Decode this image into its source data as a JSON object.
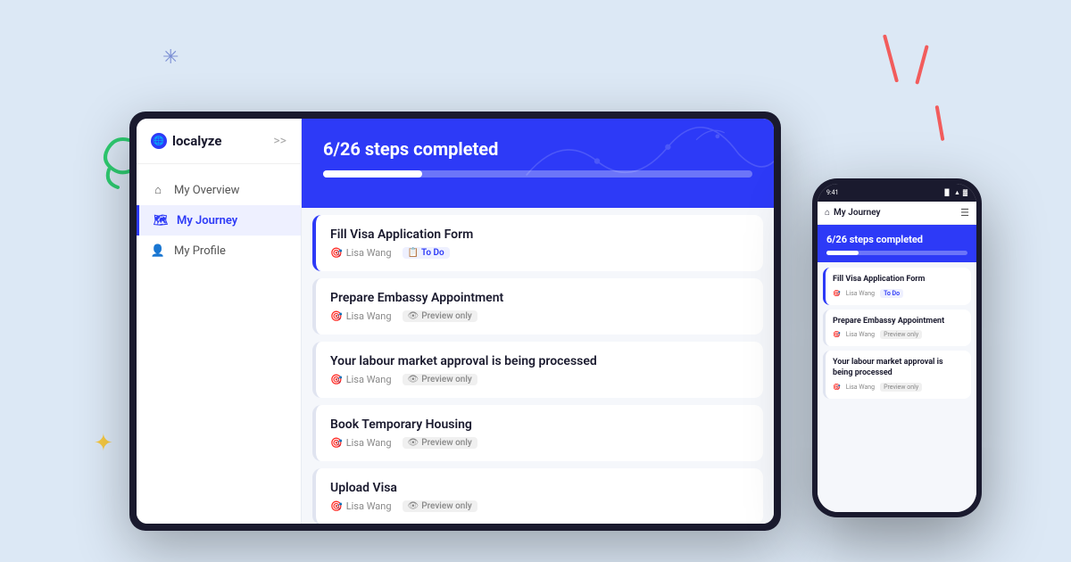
{
  "app": {
    "name": "localyze",
    "logo_icon": "🌐"
  },
  "decorations": {
    "asterisk_color": "#7b8fd4",
    "swirl_color": "#2ecc71",
    "star_color": "#f5c842",
    "line_color": "#f25c5c"
  },
  "sidebar": {
    "collapse_label": ">>",
    "items": [
      {
        "label": "My Overview",
        "icon": "home",
        "active": false
      },
      {
        "label": "My Journey",
        "icon": "map",
        "active": true
      },
      {
        "label": "My Profile",
        "icon": "user",
        "active": false
      }
    ]
  },
  "header": {
    "progress_text": "6/26 steps completed",
    "progress_percent": 23
  },
  "tasks": [
    {
      "title": "Fill Visa Application Form",
      "assignee": "Lisa Wang",
      "badge_type": "todo",
      "badge_label": "To Do"
    },
    {
      "title": "Prepare Embassy Appointment",
      "assignee": "Lisa Wang",
      "badge_type": "preview",
      "badge_label": "Preview only"
    },
    {
      "title": "Your labour market approval is being processed",
      "assignee": "Lisa Wang",
      "badge_type": "preview",
      "badge_label": "Preview only"
    },
    {
      "title": "Book Temporary Housing",
      "assignee": "Lisa Wang",
      "badge_type": "preview",
      "badge_label": "Preview only"
    },
    {
      "title": "Upload Visa",
      "assignee": "Lisa Wang",
      "badge_type": "preview",
      "badge_label": "Preview only"
    }
  ],
  "mobile": {
    "time": "9:41",
    "nav_title": "My Journey",
    "header_progress_text": "6/26 steps completed",
    "tasks": [
      {
        "title": "Fill Visa Application Form",
        "assignee": "Lisa Wang",
        "badge_type": "todo",
        "badge_label": "To Do"
      },
      {
        "title": "Prepare Embassy Appointment",
        "assignee": "Lisa Wang",
        "badge_type": "preview",
        "badge_label": "Preview only"
      },
      {
        "title": "Your labour market approval is being processed",
        "assignee": "Lisa Wang",
        "badge_type": "preview",
        "badge_label": "Preview only"
      }
    ]
  }
}
